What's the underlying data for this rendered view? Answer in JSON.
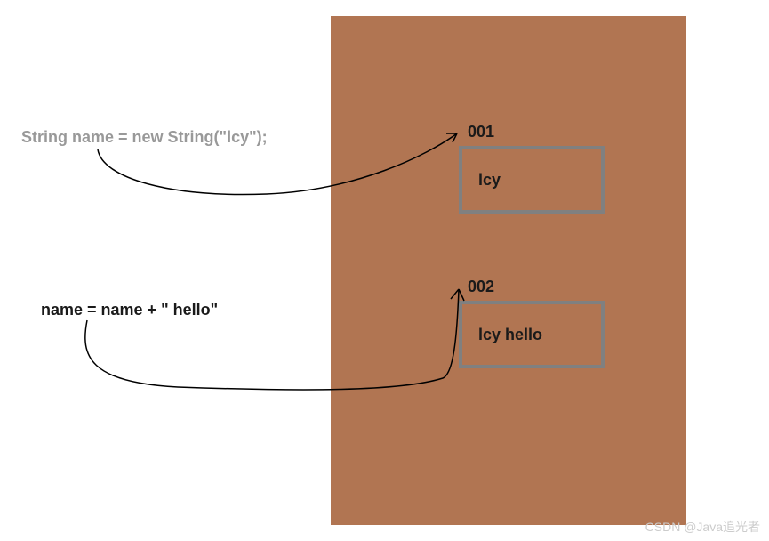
{
  "code1": "String name = new String(\"lcy\");",
  "code2": "name = name + \" hello\"",
  "addr1": "001",
  "addr2": "002",
  "val1": "lcy",
  "val2": "lcy  hello",
  "watermark": "CSDN @Java追光者",
  "colors": {
    "heap": "#b17552",
    "boxBorder": "#808080",
    "mutedText": "#999999",
    "text": "#1a1a1a"
  }
}
